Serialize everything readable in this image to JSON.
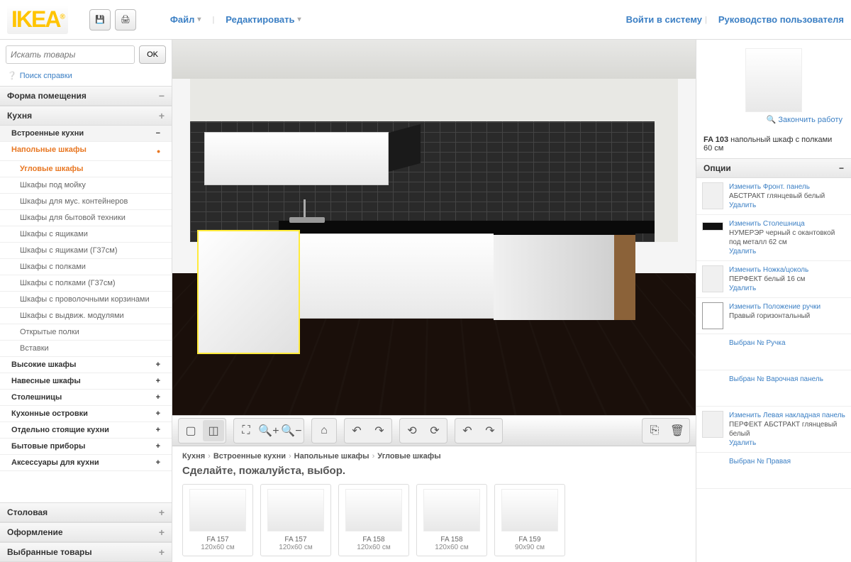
{
  "top": {
    "logo": "IKEA",
    "menu_file": "Файл",
    "menu_edit": "Редактировать",
    "login": "Войти в систему",
    "guide": "Руководство пользователя"
  },
  "search": {
    "placeholder": "Искать товары",
    "ok": "OK",
    "help": "Поиск справки"
  },
  "sidebar": {
    "room_shape": "Форма помещения",
    "kitchen": "Кухня",
    "builtin": "Встроенные кухни",
    "floor_cabinets": "Напольные шкафы",
    "corner_cabinets": "Угловые шкафы",
    "items": [
      "Шкафы под мойку",
      "Шкафы для мус. контейнеров",
      "Шкафы для бытовой техники",
      "Шкафы с ящиками",
      "Шкафы с ящиками (Г37см)",
      "Шкафы с полками",
      "Шкафы с полками (Г37см)",
      "Шкафы с проволочными корзинами",
      "Шкафы с выдвиж. модулями",
      "Открытые полки",
      "Вставки"
    ],
    "subs": [
      "Высокие шкафы",
      "Навесные шкафы",
      "Столешницы",
      "Кухонные островки"
    ],
    "standalone": "Отдельно стоящие кухни",
    "appliances": "Бытовые приборы",
    "accessories": "Аксессуары для кухни",
    "dining": "Столовая",
    "decor": "Оформление",
    "selected": "Выбранные товары"
  },
  "breadcrumb": [
    "Кухня",
    "Встроенные кухни",
    "Напольные шкафы",
    "Угловые шкафы"
  ],
  "prompt": "Сделайте, пожалуйста, выбор.",
  "products": [
    {
      "name": "FA 157",
      "dim": "120x60 см"
    },
    {
      "name": "FA 157",
      "dim": "120x60 см"
    },
    {
      "name": "FA 158",
      "dim": "120x60 см"
    },
    {
      "name": "FA 158",
      "dim": "120x60 см"
    },
    {
      "name": "FA 159",
      "dim": "90x90 см"
    }
  ],
  "right": {
    "finish": "Закончить работу",
    "item_code": "FA 103",
    "item_desc": "напольный шкаф с полками",
    "item_dim": "60 см",
    "options_head": "Опции",
    "options": [
      {
        "link": "Изменить Фронт. панель",
        "desc": "АБСТРАКТ глянцевый белый",
        "del": "Удалить",
        "swatch": "white"
      },
      {
        "link": "Изменить Столешница",
        "desc": "НУМЕРЭР черный с окантовкой под металл 62 см",
        "del": "Удалить",
        "swatch": "black"
      },
      {
        "link": "Изменить Ножка/цоколь",
        "desc": "ПЕРФЕКТ белый 16 см",
        "del": "Удалить",
        "swatch": "white"
      },
      {
        "link": "Изменить Положение ручки",
        "desc": "Правый горизонтальный",
        "del": "",
        "swatch": "handle"
      },
      {
        "link": "Выбран № Ручка",
        "desc": "",
        "del": "",
        "swatch": "none"
      },
      {
        "link": "Выбран № Варочная панель",
        "desc": "",
        "del": "",
        "swatch": "none"
      },
      {
        "link": "Изменить Левая накладная панель",
        "desc": "ПЕРФЕКТ АБСТРАКТ глянцевый белый",
        "del": "Удалить",
        "swatch": "white"
      },
      {
        "link": "Выбран № Правая",
        "desc": "",
        "del": "",
        "swatch": "none"
      }
    ]
  }
}
